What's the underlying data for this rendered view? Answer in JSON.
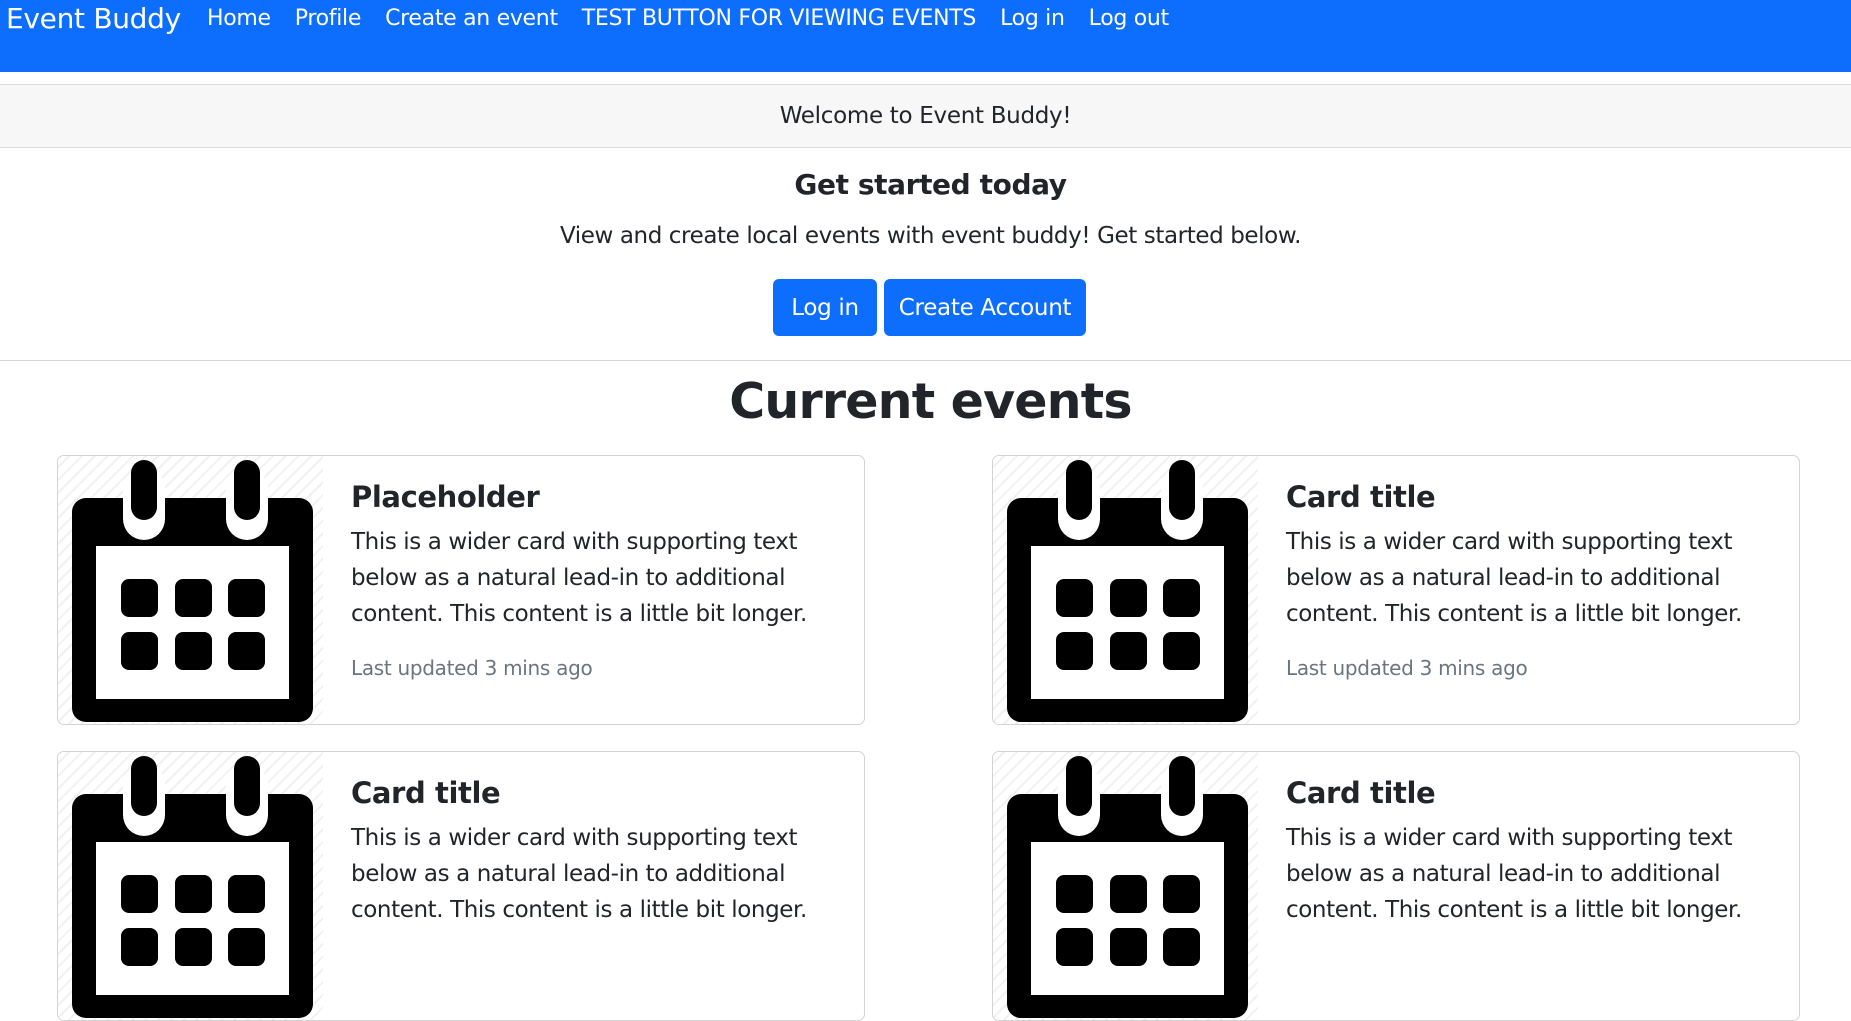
{
  "navbar": {
    "brand": "Event Buddy",
    "links": [
      "Home",
      "Profile",
      "Create an event",
      "TEST BUTTON FOR VIEWING EVENTS",
      "Log in",
      "Log out"
    ]
  },
  "welcome": "Welcome to Event Buddy!",
  "hero": {
    "title": "Get started today",
    "text": "View and create local events with event buddy! Get started below.",
    "login_label": "Log in",
    "create_label": "Create Account"
  },
  "events": {
    "heading": "Current events",
    "cards": [
      {
        "icon": "calendar-icon",
        "title": "Placeholder",
        "text": "This is a wider card with supporting text below as a natural lead-in to additional content. This content is a little bit longer.",
        "meta": "Last updated 3 mins ago"
      },
      {
        "icon": "calendar-icon",
        "title": "Card title",
        "text": "This is a wider card with supporting text below as a natural lead-in to additional content. This content is a little bit longer.",
        "meta": "Last updated 3 mins ago"
      },
      {
        "icon": "calendar-icon",
        "title": "Card title",
        "text": "This is a wider card with supporting text below as a natural lead-in to additional content. This content is a little bit longer.",
        "meta": ""
      },
      {
        "icon": "calendar-icon",
        "title": "Card title",
        "text": "This is a wider card with supporting text below as a natural lead-in to additional content. This content is a little bit longer.",
        "meta": ""
      }
    ]
  },
  "colors": {
    "primary": "#0d6efd",
    "welcome_bg": "#f7f7f7",
    "muted_text": "#6c757d"
  }
}
